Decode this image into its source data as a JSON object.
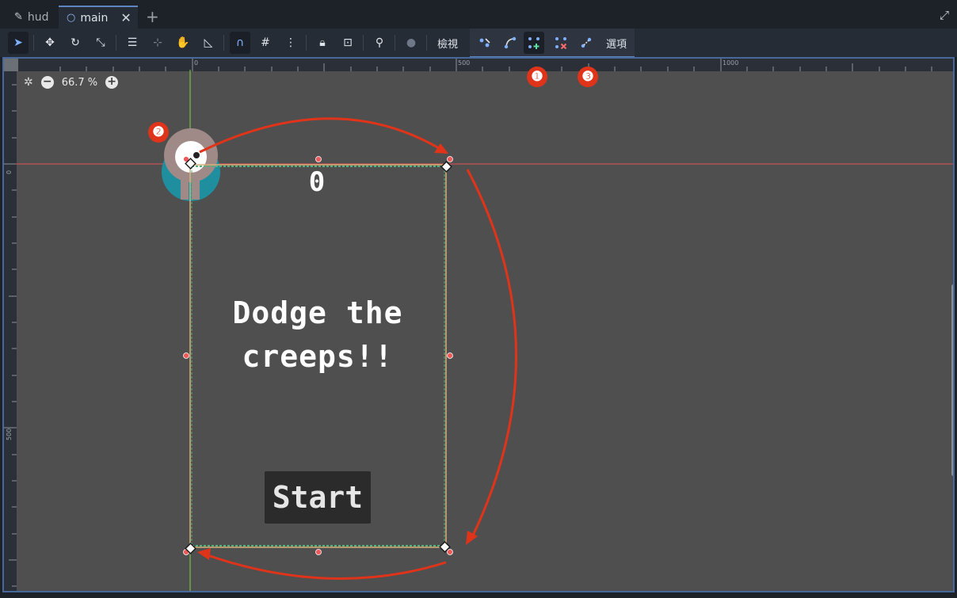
{
  "tabs": [
    {
      "label": "hud",
      "icon": "script-icon",
      "active": false
    },
    {
      "label": "main",
      "icon": "node-circle-icon",
      "active": true
    }
  ],
  "toolbar": {
    "view_label": "檢視",
    "options_label": "選項"
  },
  "viewport": {
    "zoom_label": "66.7 %",
    "ruler_top": [
      "0",
      "500",
      "1000"
    ],
    "ruler_left": [
      "0",
      "500"
    ]
  },
  "game": {
    "score": "0",
    "title": "Dodge the creeps!!",
    "start_label": "Start"
  },
  "annotations": {
    "badge_1": "❶",
    "badge_2": "❷",
    "badge_3": "❸"
  },
  "colors": {
    "accent": "#5f86c1",
    "arrow": "#e0341a",
    "viewport_bg": "#4f4f4f"
  }
}
